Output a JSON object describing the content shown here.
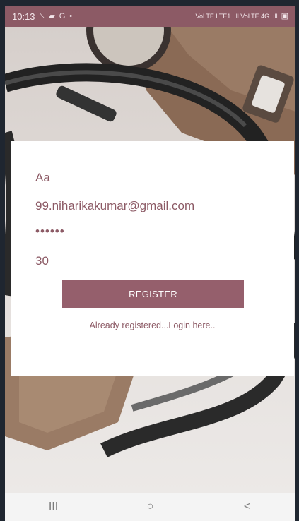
{
  "status_bar": {
    "time": "10:13",
    "left_icons": [
      "signal-slash-icon",
      "message-icon",
      "google-icon",
      "dot-icon"
    ],
    "right_text": "VoLTE LTE1 .ıll VoLTE 4G .ıll",
    "battery_icon": "battery-icon"
  },
  "form": {
    "name_value": "Aa",
    "email_value": "99.niharikakumar@gmail.com",
    "password_value": "••••••",
    "age_value": "30",
    "register_label": "REGISTER",
    "login_link": "Already registered...Login here.."
  },
  "nav_bar": {
    "recent_icon": "III",
    "home_icon": "○",
    "back_icon": "<"
  },
  "colors": {
    "accent": "#955f6c",
    "text_accent": "#8c5a65",
    "card_bg": "#ffffff",
    "nav_bg": "#f4f4f4"
  }
}
